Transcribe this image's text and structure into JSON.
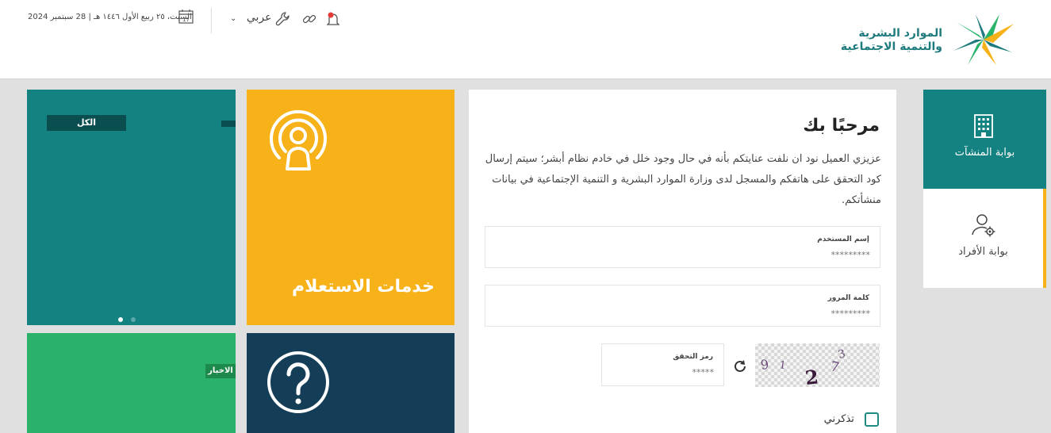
{
  "header": {
    "logo_text_line1": "الموارد البشرية",
    "logo_text_line2": "والتنمية الاجتماعية",
    "date": "السبت، ٢٥ ربيع الأول ١٤٤٦ هـ | 28 سبتمبر 2024",
    "calendar_day": "17",
    "language": "عربي",
    "icons": [
      "notification-bell-icon",
      "link-icon",
      "wrench-icon",
      "chevron-down-icon",
      "calendar-icon"
    ],
    "notification_color": "#e53935"
  },
  "tiles": {
    "slider_tag": "الكل",
    "news_tag": "الاخبار",
    "services_title": "خدمات الاستعلام",
    "colors": {
      "teal": "#158282",
      "yellow": "#f7b21a",
      "green": "#2bb26a",
      "navy": "#143e58"
    }
  },
  "login": {
    "title": "مرحبًا بك",
    "description": "عزيزي العميل نود ان نلفت عنايتكم بأنه في حال وجود خلل في خادم نظام أبشر؛ سيتم إرسال كود التحقق على هاتفكم والمسجل لدى وزارة الموارد البشرية و التنمية الإجتماعية في بيانات منشأتكم.",
    "username_label": "إسم المستخدم",
    "username_placeholder": "*********",
    "password_label": "كلمة المرور",
    "password_placeholder": "*********",
    "captcha_label": "رمز التحقق",
    "captcha_placeholder": "*****",
    "captcha_chars": [
      "9",
      "1",
      "2",
      "7",
      "3"
    ],
    "remember_label": "تذكرني",
    "accent_color": "#1f8a80"
  },
  "side_nav": {
    "items": [
      {
        "label": "بوابة المنشآت",
        "icon": "building-icon",
        "active": true
      },
      {
        "label": "بوابة الأفراد",
        "icon": "user-settings-icon",
        "active": false
      }
    ]
  }
}
